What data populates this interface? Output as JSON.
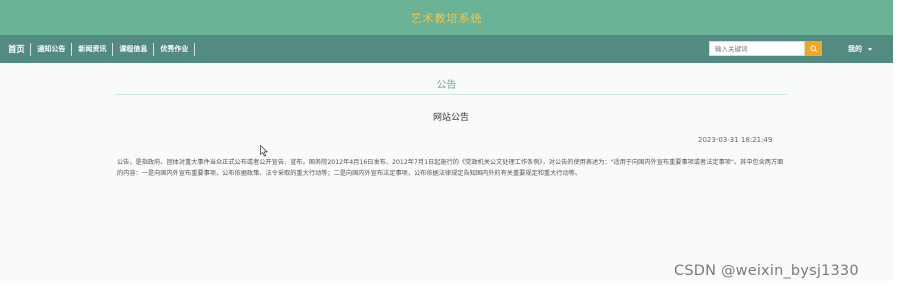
{
  "header": {
    "site_title": "艺术教培系统"
  },
  "nav": {
    "home_label": "首页",
    "items": [
      {
        "label": "通知公告"
      },
      {
        "label": "新闻资讯"
      },
      {
        "label": "课程信息"
      },
      {
        "label": "优秀作业"
      }
    ]
  },
  "search": {
    "placeholder": "输入关键词"
  },
  "user_menu": {
    "label": "我的"
  },
  "section": {
    "title": "公告"
  },
  "notice": {
    "title": "网站公告",
    "timestamp": "2023-03-31 18:21:49",
    "body": "公告，是指政府、团体对重大事件当众正式公布或者公开宣告、宣布。国务院2012年4月16日发布、2012年7月1日起施行的《党政机关公文处理工作条例》，对公告的使用表述为：\"适用于向国内外宣布重要事项或者法定事项\"。其中包含两方面的内容：一是向国内外宣布重要事项，公布依据政策、法令采取的重大行动等；二是向国内外宣布法定事项，公布依据法律规定告知国内外的有关重要规定和重大行动等。"
  },
  "watermark": {
    "text": "CSDN @weixin_bysj1330"
  },
  "colors": {
    "topbar": "#6ab396",
    "navbar": "#528b82",
    "title_text": "#f2c44e",
    "search_button": "#f5a623",
    "accent": "#6fa6a4"
  }
}
